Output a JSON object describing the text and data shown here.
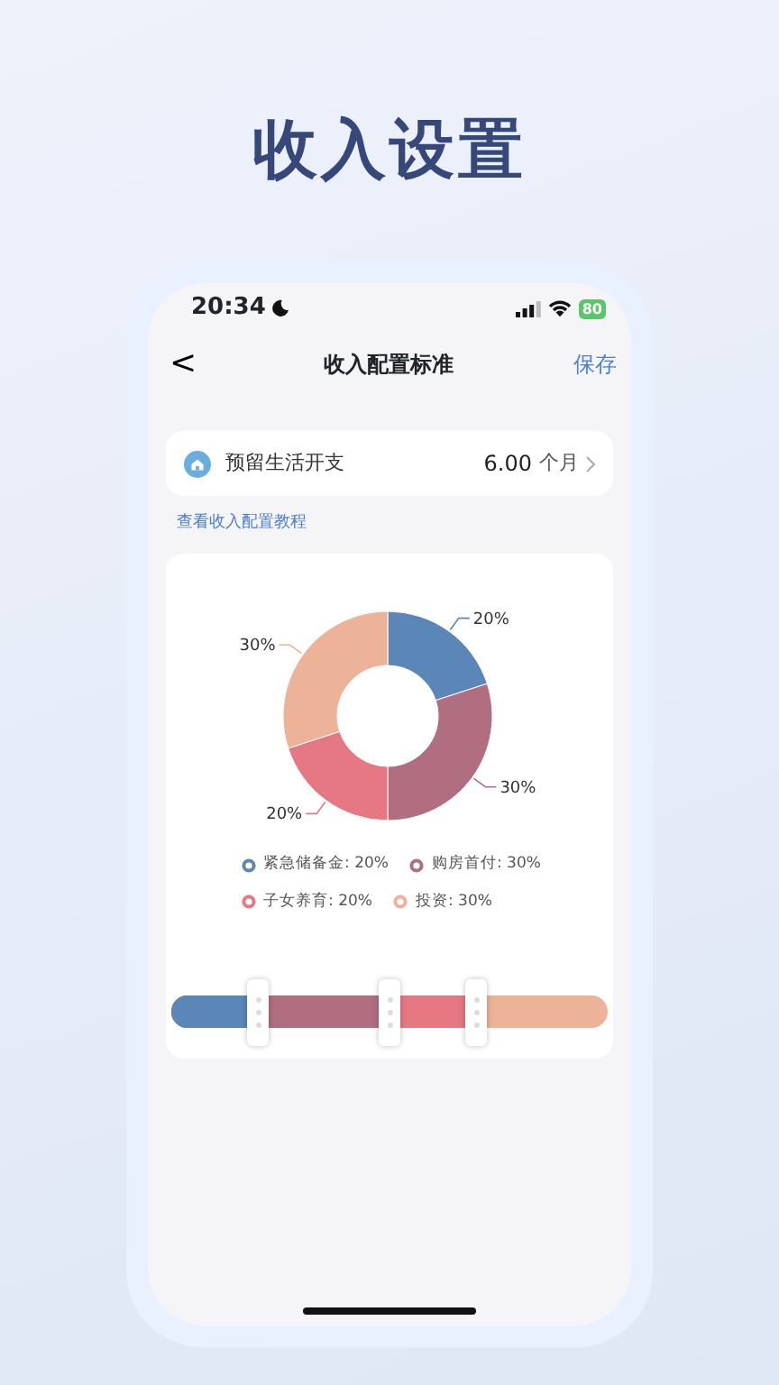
{
  "page_title": "收入设置",
  "status_bar": {
    "time": "20:34",
    "battery": "80"
  },
  "nav": {
    "back": "<",
    "title": "收入配置标准",
    "action": "保存"
  },
  "reserve_row": {
    "label": "预留生活开支",
    "value": "6.00",
    "unit": "个月"
  },
  "tutorial_link": "查看收入配置教程",
  "chart_data": {
    "type": "donut",
    "values": [
      20,
      30,
      20,
      30
    ],
    "value_labels": [
      "20%",
      "30%",
      "20%",
      "30%"
    ]
  },
  "legend": [
    {
      "label": "紧急储备金: 20%",
      "color": "#5b86b8"
    },
    {
      "label": "购房首付: 30%",
      "color": "#b06e80"
    },
    {
      "label": "子女养育: 20%",
      "color": "#e57883"
    },
    {
      "label": "投资: 30%",
      "color": "#ecb398"
    }
  ],
  "allocation_slider": {
    "handles": [
      {
        "level": 0.2
      },
      {
        "level": 0.5
      },
      {
        "level": 0.7
      }
    ]
  }
}
